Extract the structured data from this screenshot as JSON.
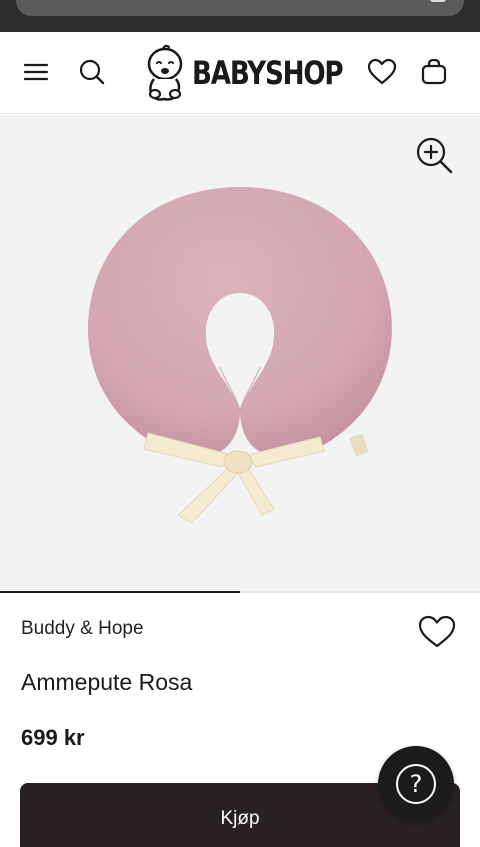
{
  "header": {
    "logo_text": "BABYSHOP"
  },
  "gallery": {
    "progress_fraction": 0.5
  },
  "product": {
    "brand": "Buddy & Hope",
    "name": "Ammepute Rosa",
    "price": "699 kr",
    "buy_label": "Kjøp"
  },
  "help": {
    "label": "?"
  },
  "colors": {
    "accent_dark": "#2a2222",
    "pillow": "#d9aeb8",
    "bow": "#f5ebd3"
  },
  "icons": [
    "menu-icon",
    "search-icon",
    "heart-icon",
    "shopping-bag-icon",
    "zoom-in-icon",
    "help-icon"
  ]
}
